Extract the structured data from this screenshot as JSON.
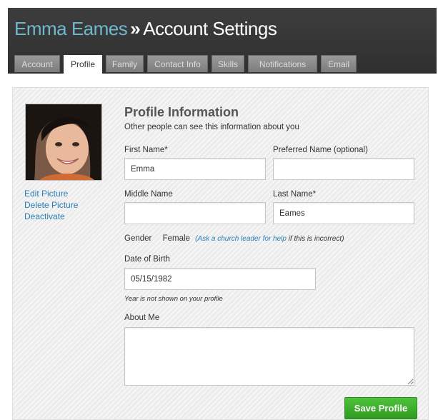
{
  "header": {
    "user_name": "Emma Eames",
    "separator": "»",
    "section_title": "Account Settings"
  },
  "tabs": [
    {
      "label": "Account",
      "active": false
    },
    {
      "label": "Profile",
      "active": true
    },
    {
      "label": "Family",
      "active": false
    },
    {
      "label": "Contact Info",
      "active": false
    },
    {
      "label": "Skills",
      "active": false
    },
    {
      "label": "Notifications",
      "active": false
    },
    {
      "label": "Email",
      "active": false
    }
  ],
  "sidebar": {
    "edit_picture": "Edit Picture",
    "delete_picture": "Delete Picture",
    "deactivate": "Deactivate"
  },
  "profile": {
    "heading": "Profile Information",
    "subheading": "Other people can see this information about you",
    "first_name_label": "First Name*",
    "first_name_value": "Emma",
    "preferred_name_label": "Preferred Name (optional)",
    "preferred_name_value": "",
    "middle_name_label": "Middle Name",
    "middle_name_value": "",
    "last_name_label": "Last Name*",
    "last_name_value": "Eames",
    "gender_label": "Gender",
    "gender_value": "Female",
    "gender_help_link": "(Ask a church leader for help",
    "gender_help_suffix": "if this is incorrect)",
    "dob_label": "Date of Birth",
    "dob_value": "05/15/1982",
    "dob_note": "Year is not shown on your profile",
    "about_label": "About Me",
    "about_value": "",
    "save_label": "Save Profile"
  },
  "colors": {
    "header_bg": "#333333",
    "user_name": "#6fb8cc",
    "link": "#2a7fb8",
    "save_button": "#3aab2b"
  }
}
